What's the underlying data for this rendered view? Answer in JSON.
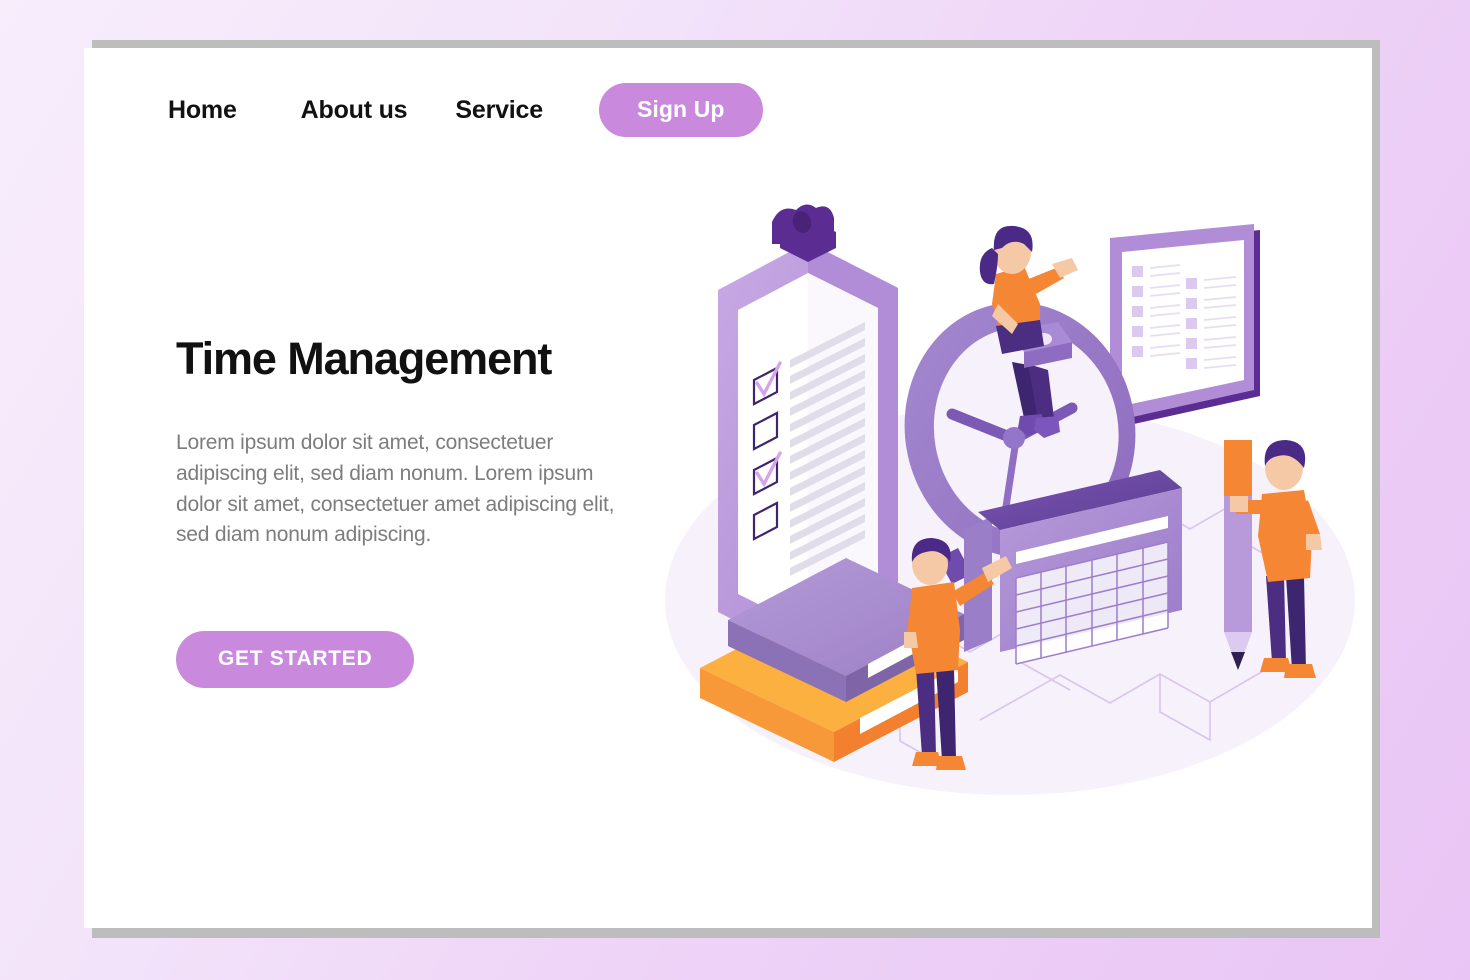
{
  "page": {
    "title": "Time Management",
    "paragraph": "Lorem ipsum dolor sit amet, consectetuer adipiscing elit, sed diam nonum. Lorem ipsum dolor sit amet, consectetuer amet adipiscing elit, sed diam nonum adipiscing.",
    "cta_label": "GET STARTED"
  },
  "nav": {
    "items": [
      {
        "label": "Home"
      },
      {
        "label": "About us"
      },
      {
        "label": "Service"
      }
    ],
    "signup_label": "Sign Up"
  },
  "colors": {
    "accent_purple": "#c98ade",
    "deep_purple": "#5b2c91",
    "mid_purple": "#8e6bbf",
    "light_purple": "#b99add",
    "pale_purple": "#e3d5f2",
    "orange": "#f58634",
    "light_orange": "#fcb040",
    "title_black": "#111111",
    "body_gray": "#7d7d7d",
    "card_white": "#ffffff",
    "frame_gray": "#bdbdbd",
    "background_lavender": "#ecd6f8"
  },
  "illustration": {
    "name": "time-management-isometric-illustration",
    "clipboard": {
      "name": "checklist-clipboard",
      "checkbox_count": 4,
      "checked_items": [
        1,
        3
      ],
      "text_line_count": 14
    },
    "clock": {
      "name": "large-wall-clock",
      "hand_count": 3
    },
    "panel": {
      "name": "list-document-panel",
      "columns": 2,
      "rows_per_column": 5
    },
    "books": {
      "name": "stacked-books",
      "count": 2,
      "top_color": "#a486c9",
      "bottom_color": "#f89939"
    },
    "calendar": {
      "name": "desk-calendar",
      "grid_columns": 6,
      "grid_rows": 5
    },
    "pencil": {
      "name": "giant-pencil"
    },
    "characters": [
      {
        "name": "woman-on-clock-with-laptop",
        "shirt": "#f58634",
        "hair": "#4b2a87"
      },
      {
        "name": "man-holding-calendar",
        "shirt": "#f58634",
        "hair": "#4b2a87"
      },
      {
        "name": "man-holding-pencil",
        "shirt": "#f58634",
        "hair": "#4b2a87"
      }
    ]
  }
}
